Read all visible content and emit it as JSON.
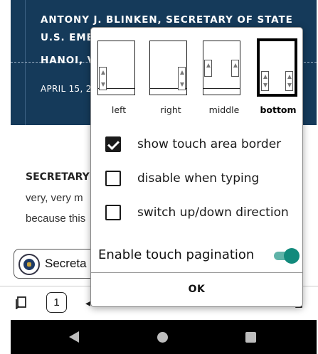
{
  "background": {
    "hero": {
      "line1": "ANTONY J. BLINKEN, SECRETARY OF STATE",
      "line2": "U.S. EMB",
      "line3": "HANOI, V",
      "date": "APRIL 15, 2"
    },
    "article": {
      "heading": "SECRETARY",
      "line1": "very, very m",
      "line2": "because this"
    },
    "chip_label": "Secreta",
    "toolbar": {
      "page_number": "1"
    },
    "colors": {
      "hero_bg": "#153a5a"
    }
  },
  "dialog": {
    "pagination_options": [
      {
        "label": "left",
        "selected": false
      },
      {
        "label": "right",
        "selected": false
      },
      {
        "label": "middle",
        "selected": false
      },
      {
        "label": "bottom",
        "selected": true
      }
    ],
    "checkboxes": [
      {
        "label": "show touch area border",
        "checked": true
      },
      {
        "label": "disable when typing",
        "checked": false
      },
      {
        "label": "switch up/down direction",
        "checked": false
      }
    ],
    "enable_label": "Enable touch pagination",
    "enable_on": true,
    "ok_label": "OK",
    "accent": "#128a7c"
  },
  "icons": [
    "bookmark-icon",
    "back-nav-icon",
    "home-nav-icon",
    "recents-nav-icon",
    "checkmark-icon",
    "seal-icon"
  ]
}
